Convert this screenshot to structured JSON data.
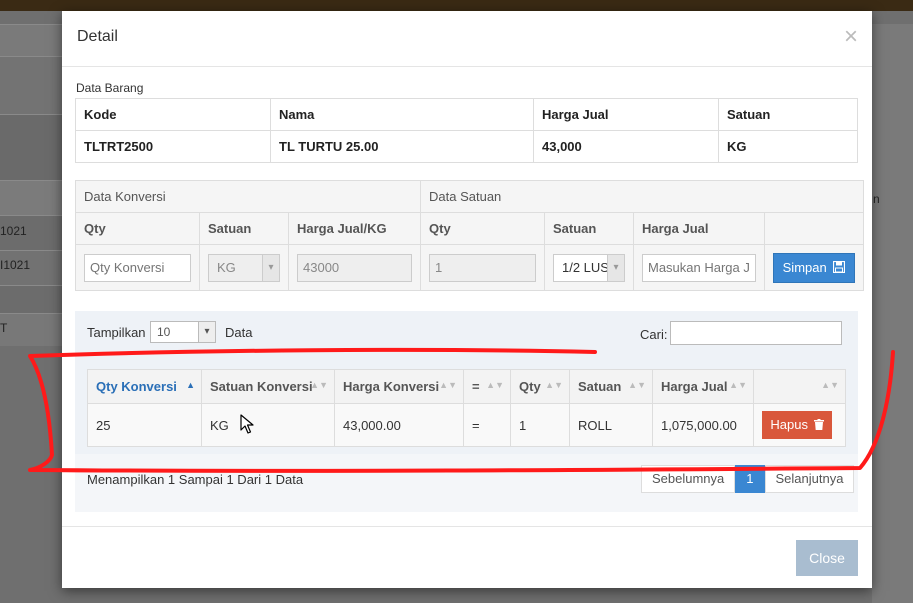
{
  "background": {
    "left_rows": [
      "1021",
      "I1021",
      "T"
    ],
    "right_text": "n"
  },
  "modal": {
    "title": "Detail",
    "close_symbol": "×",
    "data_barang": {
      "section_label": "Data Barang",
      "headers": [
        "Kode",
        "Nama",
        "Harga Jual",
        "Satuan"
      ],
      "row": [
        "TLTRT2500",
        "TL TURTU 25.00",
        "43,000",
        "KG"
      ]
    },
    "conversion_form": {
      "group_konversi": "Data Konversi",
      "group_satuan": "Data Satuan",
      "headers": [
        "Qty",
        "Satuan",
        "Harga Jual/KG",
        "Qty",
        "Satuan",
        "Harga Jual"
      ],
      "qty_placeholder": "Qty Konversi",
      "satuan_value": "KG",
      "harga_value": "43000",
      "qty_satuan_value": "1",
      "satuan_select": "1/2 LUS",
      "harga_jual_placeholder": "Masukan Harga Jual",
      "save_label": "Simpan",
      "save_icon": "floppy-disk-icon"
    },
    "datatable": {
      "length_label": "Tampilkan",
      "length_value": "10",
      "length_suffix": "Data",
      "search_label": "Cari:",
      "columns": [
        "Qty Konversi",
        "Satuan Konversi",
        "Harga Konversi",
        "=",
        "Qty",
        "Satuan",
        "Harga Jual",
        ""
      ],
      "rows": [
        {
          "qty_konversi": "25",
          "satuan_konversi": "KG",
          "harga_konversi": "43,000.00",
          "eq": "=",
          "qty": "1",
          "satuan": "ROLL",
          "harga_jual": "1,075,000.00",
          "action": "Hapus"
        }
      ],
      "delete_icon": "trash-icon",
      "info": "Menampilkan 1 Sampai 1 Dari 1 Data",
      "pagination": {
        "prev": "Sebelumnya",
        "current": "1",
        "next": "Selanjutnya"
      }
    },
    "footer": {
      "close_label": "Close"
    }
  },
  "colors": {
    "primary": "#3a87d2",
    "danger": "#d9573b",
    "annotation": "#ff1a1a",
    "close_button": "#a9bdd0"
  }
}
